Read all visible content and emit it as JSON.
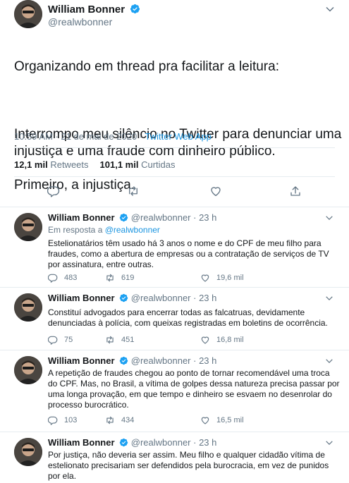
{
  "main": {
    "name": "William Bonner",
    "handle": "@realwbonner",
    "text_line1": "Organizando em thread pra facilitar a leitura:",
    "text_line2": "Interrompo meu silêncio no Twitter para denunciar uma injustiça e uma fraude com dinheiro público.",
    "text_line3": "Primeiro, a injustiça.",
    "datetime": "10:59 AM · 21 de mai de 2020 · ",
    "app": "Twitter Web App",
    "retweets_count": "12,1 mil",
    "retweets_label": "Retweets",
    "likes_count": "101,1 mil",
    "likes_label": "Curtidas",
    "icons": [
      "reply-icon",
      "retweet-icon",
      "like-icon",
      "share-icon"
    ]
  },
  "replies": [
    {
      "name": "William Bonner",
      "handle": "@realwbonner",
      "time": "· 23 h",
      "in_reply_prefix": "Em resposta a ",
      "in_reply_handle": "@realwbonner",
      "text": "Estelionatários têm usado há 3 anos o nome e do CPF de meu filho para fraudes, como a abertura de empresas ou a contratação de  serviços de TV por assinatura, entre outras.",
      "replies": "483",
      "retweets": "619",
      "likes": "19,6 mil"
    },
    {
      "name": "William Bonner",
      "handle": "@realwbonner",
      "time": "· 23 h",
      "text": "Constituí advogados para encerrar todas as falcatruas, devidamente denunciadas à polícia, com queixas registradas em boletins de ocorrência.",
      "replies": "75",
      "retweets": "451",
      "likes": "16,8 mil"
    },
    {
      "name": "William Bonner",
      "handle": "@realwbonner",
      "time": "· 23 h",
      "text": "A repetição de fraudes chegou ao ponto de tornar recomendável uma troca do CPF. Mas, no Brasil, a vítima de golpes dessa natureza precisa passar por uma longa provação, em que tempo e dinheiro se esvaem no desenrolar do processo burocrático.",
      "replies": "103",
      "retweets": "434",
      "likes": "16,5 mil"
    },
    {
      "name": "William Bonner",
      "handle": "@realwbonner",
      "time": "· 23 h",
      "text": "Por justiça, não deveria ser assim. Meu filho e qualquer cidadão vítima de estelionato precisariam ser defendidos pela burocracia, em vez de punidos por ela."
    }
  ],
  "colors": {
    "accent": "#1da1f2",
    "link": "#1b95e0",
    "muted": "#657786",
    "text": "#14171a",
    "divider": "#e6ecf0"
  }
}
